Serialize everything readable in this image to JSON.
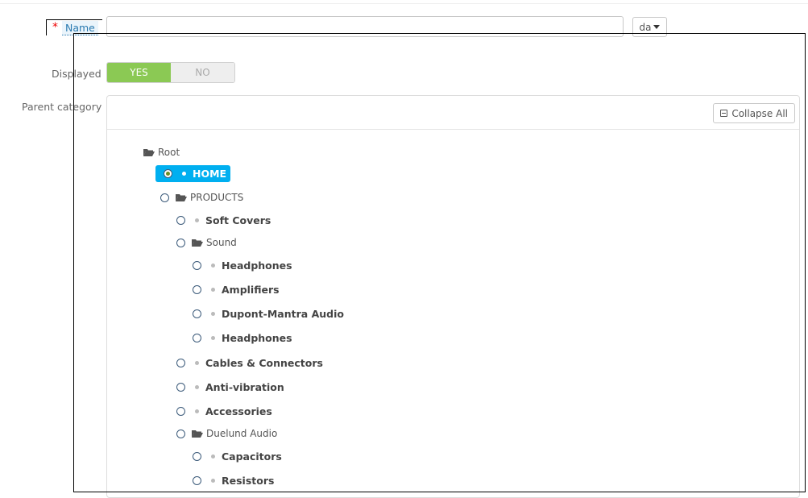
{
  "form": {
    "required_mark": "*",
    "name_label": "Name",
    "name_value": "",
    "language": "da",
    "displayed_label": "Displayed",
    "displayed_yes": "YES",
    "displayed_no": "NO",
    "displayed_selected": "YES",
    "parent_category_label": "Parent category"
  },
  "tree": {
    "collapse_all_label": "Collapse All",
    "selected_node": "HOME",
    "root": "Root",
    "home": "HOME",
    "products": "PRODUCTS",
    "soft_covers": "Soft Covers",
    "sound": "Sound",
    "headphones_1": "Headphones",
    "amplifiers": "Amplifiers",
    "dupont_mantra": "Dupont-Mantra Audio",
    "headphones_2": "Headphones",
    "cables": "Cables & Connectors",
    "anti_vibration": "Anti-vibration",
    "accessories": "Accessories",
    "duelund": "Duelund Audio",
    "capacitors": "Capacitors",
    "resistors": "Resistors"
  },
  "colors": {
    "accent_selected": "#00aff0",
    "toggle_yes": "#8bc954",
    "required": "#ee0000"
  }
}
